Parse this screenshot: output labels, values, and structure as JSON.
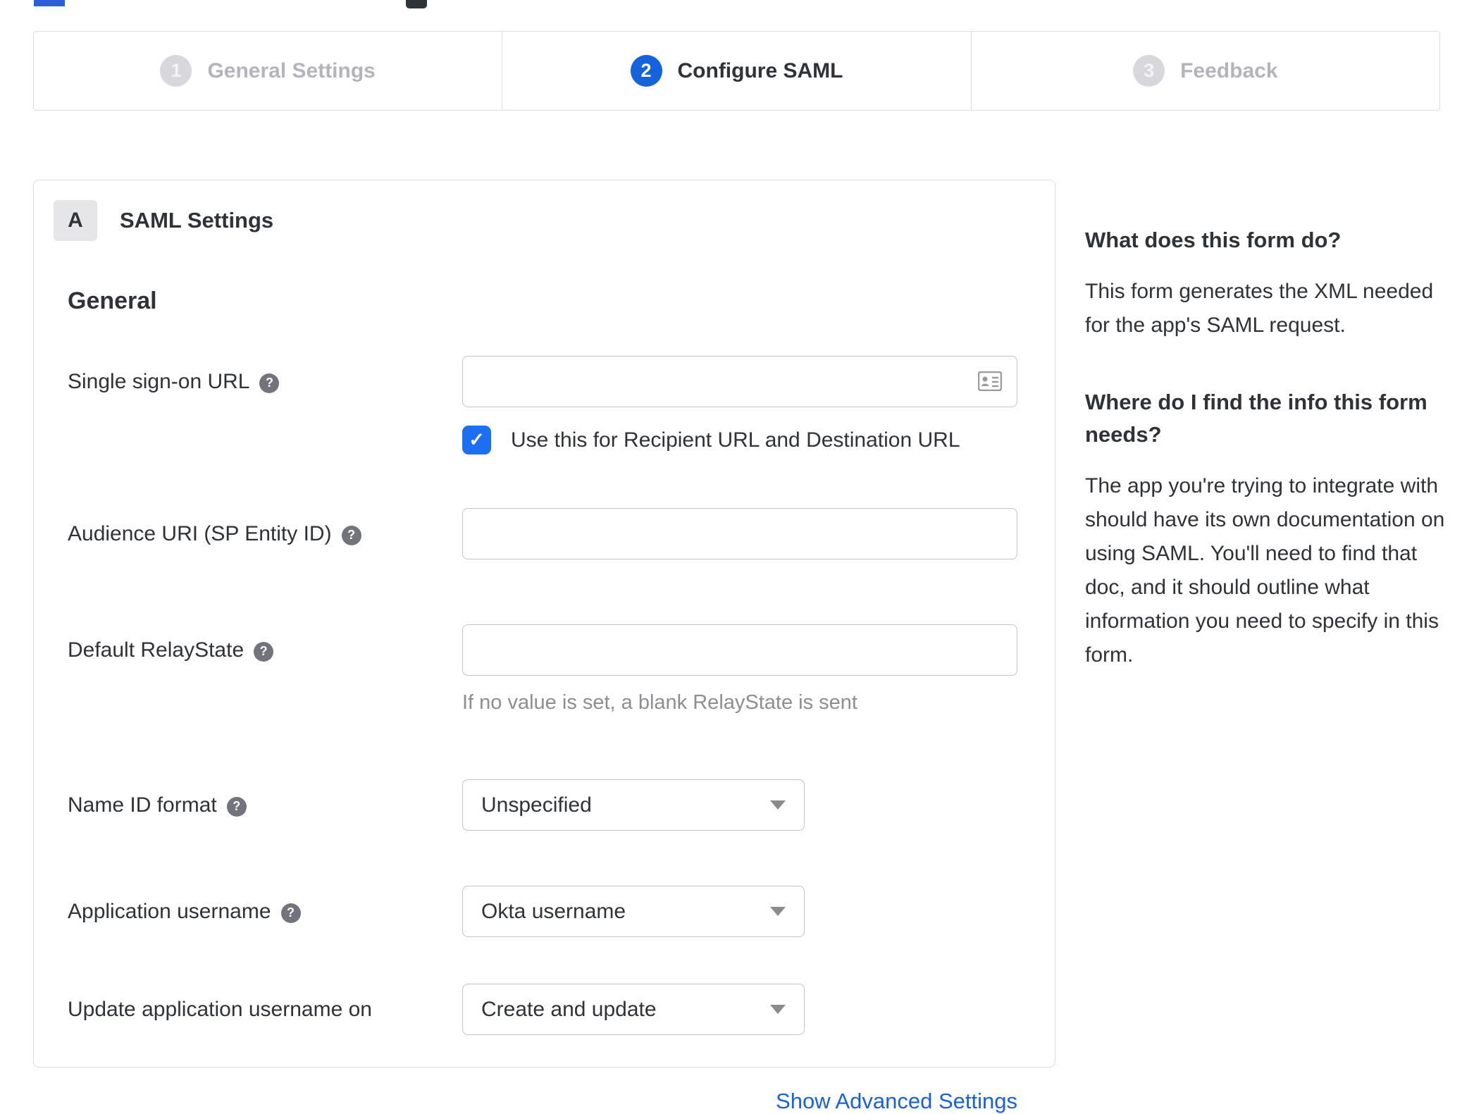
{
  "stepper": {
    "steps": [
      {
        "number": "1",
        "label": "General Settings",
        "state": "inactive"
      },
      {
        "number": "2",
        "label": "Configure SAML",
        "state": "active"
      },
      {
        "number": "3",
        "label": "Feedback",
        "state": "inactive"
      }
    ]
  },
  "panel": {
    "badge": "A",
    "title": "SAML Settings",
    "group": "General",
    "fields": {
      "sso": {
        "label": "Single sign-on URL",
        "value": ""
      },
      "sso_check": {
        "label": "Use this for Recipient URL and Destination URL",
        "checked": true
      },
      "audience": {
        "label": "Audience URI (SP Entity ID)",
        "value": ""
      },
      "relay": {
        "label": "Default RelayState",
        "value": "",
        "hint": "If no value is set, a blank RelayState is sent"
      },
      "nameid": {
        "label": "Name ID format",
        "value": "Unspecified"
      },
      "appuser": {
        "label": "Application username",
        "value": "Okta username"
      },
      "update": {
        "label": "Update application username on",
        "value": "Create and update"
      }
    },
    "advanced_link": "Show Advanced Settings"
  },
  "sidebar": {
    "sections": [
      {
        "title": "What does this form do?",
        "body": "This form generates the XML needed for the app's SAML request."
      },
      {
        "title": "Where do I find the info this form needs?",
        "body": "The app you're trying to integrate with should have its own documentation on using SAML. You'll need to find that doc, and it should outline what information you need to specify in this form."
      }
    ]
  },
  "icons": {
    "help": "?",
    "check": "✓"
  },
  "colors": {
    "accent": "#1662dd",
    "checkbox": "#1c6ef2",
    "inactive_circle": "#d7d7dc",
    "border": "#dddddd",
    "text": "#2f3237",
    "muted": "#8d8d93"
  }
}
